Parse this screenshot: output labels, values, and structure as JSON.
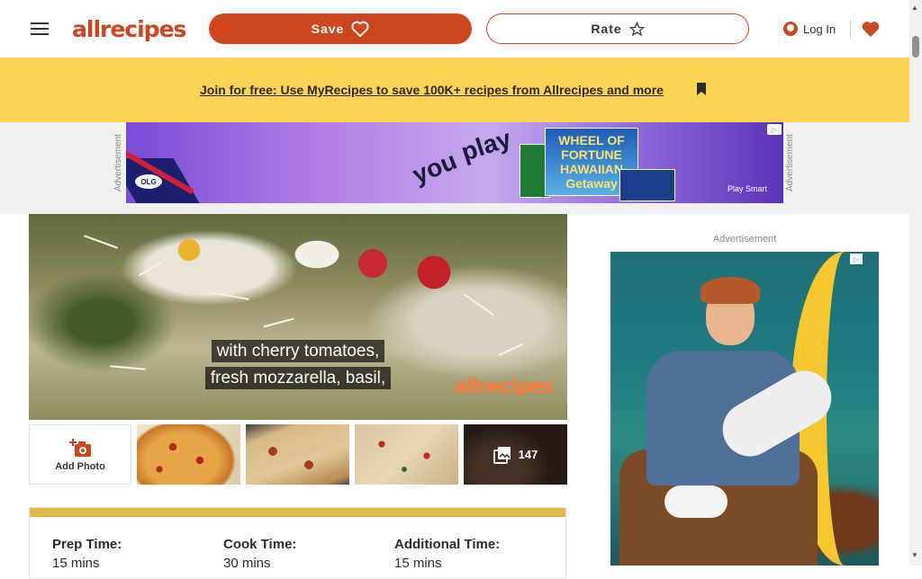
{
  "header": {
    "logo_text": "allrecipes",
    "save_label": "Save",
    "rate_label": "Rate",
    "login_label": "Log In"
  },
  "banner": {
    "link_text": "Join for free: Use MyRecipes to save 100K+ recipes from Allrecipes and more"
  },
  "ads": {
    "label": "Advertisement",
    "top_ad": {
      "brand": "OLG",
      "slogan_words": [
        "you",
        "play"
      ],
      "ticket_text": "WHEEL OF FORTUNE HAWAIIAN Getaway",
      "footer": "Play Smart"
    }
  },
  "video": {
    "caption_line1": "with cherry tomatoes,",
    "caption_line2": "fresh mozzarella, basil,",
    "watermark": "allrecipes"
  },
  "photos": {
    "add_photo_label": "Add Photo",
    "more_count": "147"
  },
  "recipe_details": {
    "columns": [
      {
        "label": "Prep Time:",
        "value": "15 mins"
      },
      {
        "label": "Cook Time:",
        "value": "30 mins"
      },
      {
        "label": "Additional Time:",
        "value": "15 mins"
      }
    ]
  },
  "colors": {
    "brand": "#ce4620",
    "banner": "#fdd353",
    "card_accent": "#e6b84a"
  }
}
